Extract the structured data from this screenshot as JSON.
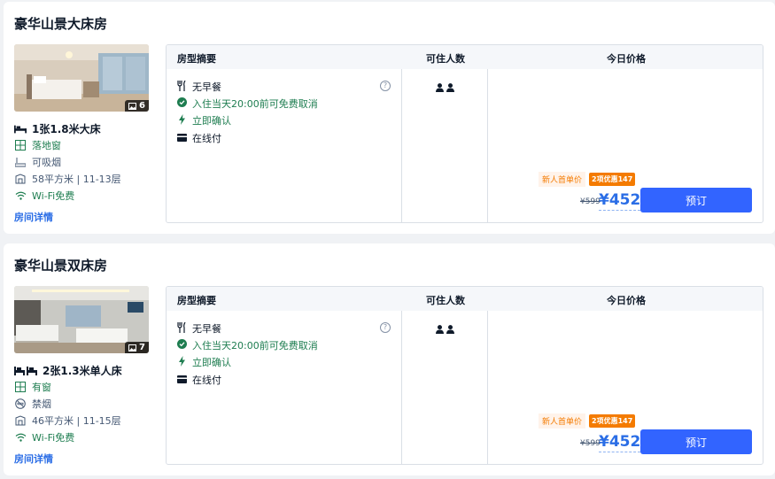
{
  "rooms": [
    {
      "title": "豪华山景大床房",
      "photo_count": "6",
      "bed": "1张1.8米大床",
      "window": "落地窗",
      "smoking": "可吸烟",
      "area_floor": "58平方米 | 11-13层",
      "wifi": "Wi-Fi免费",
      "detail_link": "房间详情",
      "header": {
        "summary": "房型摘要",
        "occupancy": "可住人数",
        "price": "今日价格"
      },
      "policies": {
        "breakfast": "无早餐",
        "cancel": "入住当天20:00前可免费取消",
        "confirm": "立即确认",
        "payment": "在线付"
      },
      "promo": {
        "new_price": "新人首单价",
        "discount": "2项优惠147"
      },
      "original_price": "¥599",
      "price": "¥452",
      "book": "预订"
    },
    {
      "title": "豪华山景双床房",
      "photo_count": "7",
      "bed": "2张1.3米单人床",
      "window": "有窗",
      "smoking": "禁烟",
      "area_floor": "46平方米 | 11-15层",
      "wifi": "Wi-Fi免费",
      "detail_link": "房间详情",
      "header": {
        "summary": "房型摘要",
        "occupancy": "可住人数",
        "price": "今日价格"
      },
      "policies": {
        "breakfast": "无早餐",
        "cancel": "入住当天20:00前可免费取消",
        "confirm": "立即确认",
        "payment": "在线付"
      },
      "promo": {
        "new_price": "新人首单价",
        "discount": "2项优惠147"
      },
      "original_price": "¥599",
      "price": "¥452",
      "book": "预订"
    }
  ],
  "colors": {
    "accent_blue": "#3264ff",
    "price_blue": "#2b6ee6",
    "green": "#1e7d50",
    "orange": "#f47b00"
  },
  "icons": [
    "bed-icon",
    "window-icon",
    "smoking-icon",
    "no-smoking-icon",
    "area-icon",
    "wifi-icon",
    "cutlery-icon",
    "check-circle-icon",
    "lightning-icon",
    "card-icon",
    "help-icon",
    "person-icon",
    "photo-icon"
  ]
}
